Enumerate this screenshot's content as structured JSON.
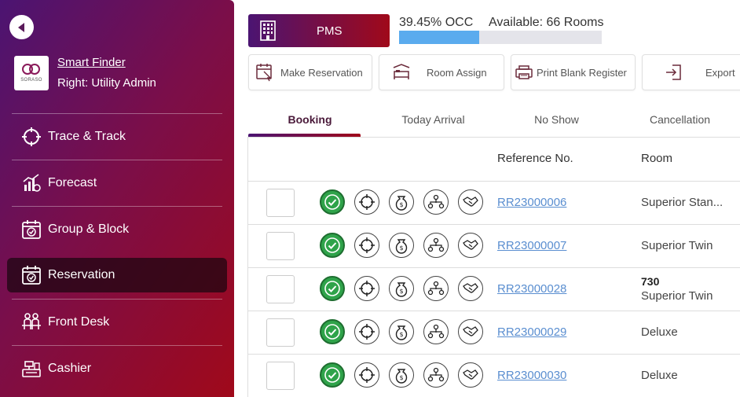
{
  "sidebar": {
    "user": {
      "finder_label": "Smart Finder",
      "right_label": "Right: Utility Admin",
      "logo_text": "SORASO"
    },
    "items": [
      {
        "label": "Trace & Track",
        "icon": "crosshair-icon"
      },
      {
        "label": "Forecast",
        "icon": "chart-icon"
      },
      {
        "label": "Group & Block",
        "icon": "calendar-check-icon"
      },
      {
        "label": "Reservation",
        "icon": "calendar-check-icon",
        "active": true
      },
      {
        "label": "Front Desk",
        "icon": "front-desk-icon"
      },
      {
        "label": "Cashier",
        "icon": "cash-register-icon"
      }
    ]
  },
  "header": {
    "module": "PMS",
    "occupancy_text": "39.45% OCC",
    "occupancy_value": 39.45,
    "available_text": "Available: 66 Rooms"
  },
  "actions": [
    {
      "label": "Make Reservation"
    },
    {
      "label": "Room Assign"
    },
    {
      "label": "Print Blank Register"
    },
    {
      "label": "Export"
    }
  ],
  "tabs": [
    {
      "label": "Booking",
      "active": true
    },
    {
      "label": "Today Arrival"
    },
    {
      "label": "No Show"
    },
    {
      "label": "Cancellation"
    }
  ],
  "table": {
    "headers": {
      "ref": "Reference No.",
      "room": "Room"
    },
    "rows": [
      {
        "ref": "RR23000006",
        "room_number": "",
        "room": "Superior Stan..."
      },
      {
        "ref": "RR23000007",
        "room_number": "",
        "room": "Superior Twin"
      },
      {
        "ref": "RR23000028",
        "room_number": "730",
        "room": "Superior Twin"
      },
      {
        "ref": "RR23000029",
        "room_number": "",
        "room": "Deluxe"
      },
      {
        "ref": "RR23000030",
        "room_number": "",
        "room": "Deluxe"
      }
    ]
  },
  "colors": {
    "accent_start": "#4b1472",
    "accent_end": "#a0091a",
    "occupancy_fill": "#5aabee",
    "status_ok": "#2fa34a",
    "link": "#5a8ed0"
  }
}
